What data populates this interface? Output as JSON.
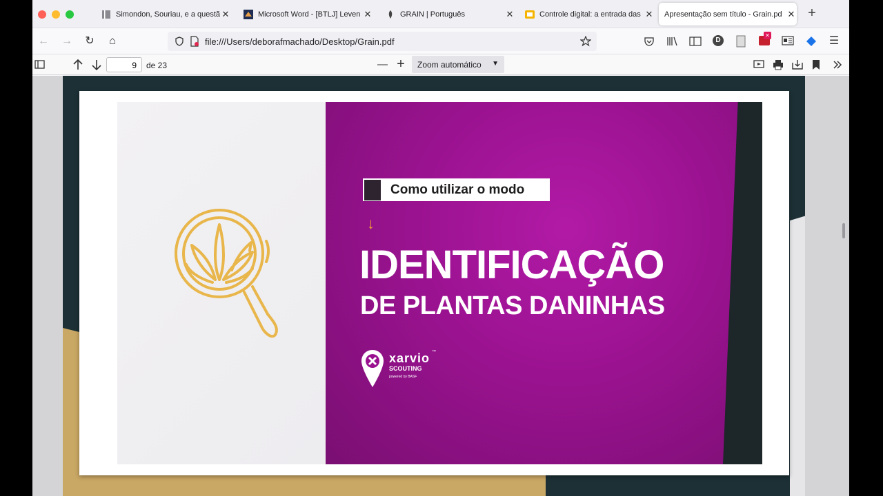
{
  "tabs": [
    {
      "title": "Simondon, Souriau, e a questã",
      "close": "✕",
      "icon": "book-icon"
    },
    {
      "title": "Microsoft Word - [BTLJ] Leven",
      "close": "✕",
      "icon": "word-doc-icon"
    },
    {
      "title": "GRAIN | Português",
      "close": "✕",
      "icon": "grain-icon"
    },
    {
      "title": "Controle digital: a entrada das",
      "close": "✕",
      "icon": "slides-icon"
    },
    {
      "title": "Apresentação sem título - Grain.pd",
      "close": "✕",
      "icon": "none"
    }
  ],
  "new_tab": "+",
  "nav": {
    "back": "←",
    "forward": "→",
    "reload": "↻",
    "home": "⌂"
  },
  "address": {
    "url": "file:///Users/deborafmachado/Desktop/Grain.pdf"
  },
  "toolbar": {
    "account_letter": "D",
    "menu": "☰"
  },
  "pdf": {
    "page": "9",
    "page_of": "de 23",
    "zoom_out": "—",
    "zoom_in": "+",
    "zoom": "Zoom automático"
  },
  "slide": {
    "banner": "Como utilizar o modo",
    "arrow": "↓",
    "title_line1": "IDENTIFICAÇÃO",
    "title_line2": "DE PLANTAS DANINHAS",
    "brand_name": "xarvio",
    "brand_tm": "™",
    "brand_sub": "SCOUTING",
    "brand_powered": "powered by BASF"
  },
  "colors": {
    "magenta": "#9a1290",
    "accent": "#f0a030",
    "icon_gold": "#e8b64a",
    "dark": "#1c3035"
  }
}
